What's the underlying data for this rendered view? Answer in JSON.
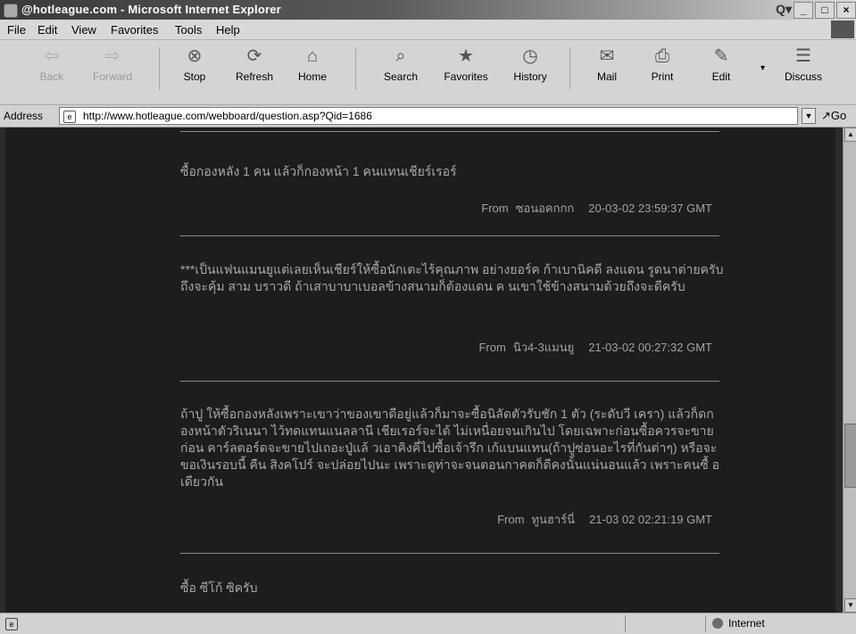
{
  "window": {
    "title": "@hotleague.com - Microsoft Internet Explorer",
    "minimize": "_",
    "maximize": "□",
    "close": "×",
    "search_glyph": "Q▾"
  },
  "menu": [
    "File",
    "Edit",
    "View",
    "Favorites",
    "Tools",
    "Help"
  ],
  "toolbar": [
    {
      "label": "Back",
      "icon": "back-arrow-icon",
      "glyph": "⇦",
      "enabled": false
    },
    {
      "label": "Forward",
      "icon": "forward-arrow-icon",
      "glyph": "⇨",
      "enabled": false
    },
    {
      "label": "Stop",
      "icon": "stop-icon",
      "glyph": "⊗",
      "enabled": true
    },
    {
      "label": "Refresh",
      "icon": "refresh-icon",
      "glyph": "⟳",
      "enabled": true
    },
    {
      "label": "Home",
      "icon": "home-icon",
      "glyph": "⌂",
      "enabled": true
    },
    {
      "label": "Search",
      "icon": "search-icon",
      "glyph": "⌕",
      "enabled": true
    },
    {
      "label": "Favorites",
      "icon": "favorites-icon",
      "glyph": "★",
      "enabled": true
    },
    {
      "label": "History",
      "icon": "history-icon",
      "glyph": "◷",
      "enabled": true
    },
    {
      "label": "Mail",
      "icon": "mail-icon",
      "glyph": "✉",
      "enabled": true
    },
    {
      "label": "Print",
      "icon": "print-icon",
      "glyph": "⎙",
      "enabled": true
    },
    {
      "label": "Edit",
      "icon": "edit-icon",
      "glyph": "✎",
      "enabled": true
    },
    {
      "label": "Discuss",
      "icon": "discuss-icon",
      "glyph": "☰",
      "enabled": true
    }
  ],
  "address": {
    "label": "Address",
    "url": "http://www.hotleague.com/webboard/question.asp?Qid=1686",
    "go_label": "Go"
  },
  "posts": [
    {
      "text": "ซื้อกองหลัง 1 คน แล้วก็กองหน้า 1 คนแทนเชียร์เรอร์",
      "from_label": "From",
      "author": "ซอนอคกกก",
      "timestamp": "20-03-02 23:59:37 GMT"
    },
    {
      "text": "***เป็นแฟนแมนยูแต่เลยเห็นเชียร์ให้ซื้อนักเตะไร้คุณภาพ อย่างยอร์ค ก้าเบานิคดี ลงแดน รูดนาต่ายครับถึงจะคุ้ม สาม บราวดี ถ้าเสาบาบาเบอลข้างสนามก็ต้องแดน ค นเขาใช้ข้างสนามด้วยถึงจะดีครับ",
      "from_label": "From",
      "author": "นิว4-3แมนยู",
      "timestamp": "21-03-02 00:27:32 GMT"
    },
    {
      "text": "ถ้าปู ให้ซื้อกองหลังเพราะเขาว่าของเขาดีอยู่แล้วก็มาจะซื้อนิลัดตัวรับชัก 1 ตัว (ระดับวี เครา) แล้วก็ดกองหน้าตัวริเนนา ไว้ทดแทนแนลลานี เชียเรอร์จะได้ ไม่เหนื่อยจนเกินไป โดยเฉพาะก่อนซื้อควรจะขายก่อน คาร์ลตอร์ดจะขายไปเถอะปู่แล้ วเอาคิงคี่ไปซื้อเจ้ารึก เก้แบนแทน(ถ้าปูซ่อนอะไรที่กันต่าๆ) หรือจะขอเงินรอบนี้ คืน สิงคโปร์ จะปล่อยไปนะ เพราะดูท่าจะจนตอนกาคตก็ดีคงนั้นแน่นอนแล้ว เพราะคนซื้ อเดียวกัน",
      "from_label": "From",
      "author": "ทูนฮาร์นี่",
      "timestamp": "21-03 02 02:21:19 GMT"
    },
    {
      "text": "ซื้อ ซีโก้ ซิครับ"
    }
  ],
  "status": {
    "zone": "Internet"
  },
  "colors": {
    "page_background": "#1d1d1d",
    "post_text": "#a8a8a8",
    "chrome": "#d4d4d4"
  }
}
